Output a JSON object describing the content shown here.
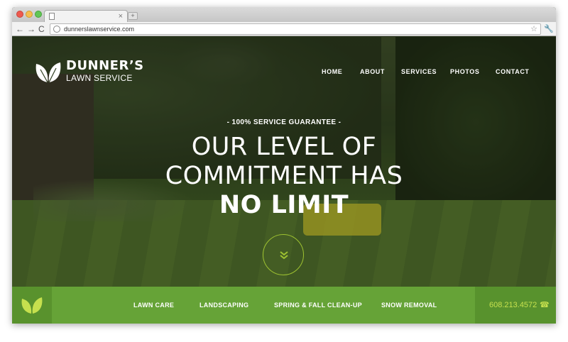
{
  "browser": {
    "tab_close": "×",
    "newtab": "+",
    "url": "dunnerslawnservice.com",
    "back": "←",
    "forward": "→",
    "reload": "C",
    "star": "☆",
    "wrench": "🔧"
  },
  "logo": {
    "name": "DUNNER’S",
    "subtitle": "LAWN SERVICE"
  },
  "nav": {
    "home": "HOME",
    "about": "ABOUT",
    "services": "SERVICES",
    "photos": "PHOTOS",
    "contact": "CONTACT"
  },
  "hero": {
    "eyebrow": "- 100% SERVICE GUARANTEE -",
    "line1": "OUR LEVEL OF",
    "line2": "COMMITMENT HAS",
    "line3": "NO LIMIT"
  },
  "services": {
    "lawn_care": "LAWN CARE",
    "landscaping": "LANDSCAPING",
    "cleanup": "SPRING & FALL CLEAN-UP",
    "snow": "SNOW REMOVAL"
  },
  "contact": {
    "phone": "608.213.4572",
    "phone_icon": "☎"
  },
  "colors": {
    "accent_green": "#66a337",
    "phone_green": "#c6e04e",
    "ring": "#9ec231"
  },
  "icons": {
    "logo": "leaf-icon",
    "scroll": "double-chevron-down-icon",
    "bar": "leaf-icon",
    "phone": "phone-icon"
  }
}
